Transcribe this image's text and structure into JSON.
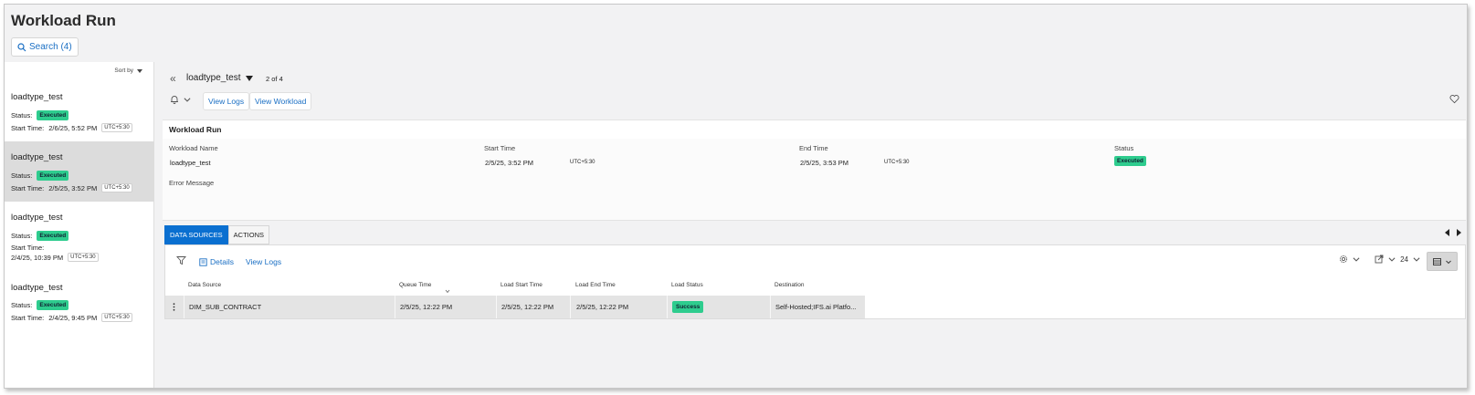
{
  "page": {
    "title": "Workload Run",
    "search_label": "Search (4)"
  },
  "sidebar": {
    "sort_label": "Sort by",
    "items": [
      {
        "name": "loadtype_test",
        "status_label": "Status:",
        "status": "Executed",
        "start_label": "Start Time:",
        "start_time": "2/6/25, 5:52 PM",
        "tz": "UTC+5:30"
      },
      {
        "name": "loadtype_test",
        "status_label": "Status:",
        "status": "Executed",
        "start_label": "Start Time:",
        "start_time": "2/5/25, 3:52 PM",
        "tz": "UTC+5:30"
      },
      {
        "name": "loadtype_test",
        "status_label": "Status:",
        "status": "Executed",
        "start_label": "Start Time:",
        "start_time": "2/4/25, 10:39 PM",
        "tz": "UTC+5:30"
      },
      {
        "name": "loadtype_test",
        "status_label": "Status:",
        "status": "Executed",
        "start_label": "Start Time:",
        "start_time": "2/4/25, 9:45 PM",
        "tz": "UTC+5:30"
      }
    ]
  },
  "header": {
    "run_name": "loadtype_test",
    "page_count": "2 of 4",
    "view_logs": "View Logs",
    "view_workload": "View Workload"
  },
  "workload_run": {
    "title": "Workload Run",
    "workload_name_label": "Workload Name",
    "workload_name": "loadtype_test",
    "start_time_label": "Start Time",
    "start_time": "2/5/25, 3:52 PM",
    "start_tz": "UTC+5:30",
    "end_time_label": "End Time",
    "end_time": "2/5/25, 3:53 PM",
    "end_tz": "UTC+5:30",
    "status_label": "Status",
    "status": "Executed",
    "error_label": "Error Message"
  },
  "tabs": [
    {
      "label": "DATA SOURCES"
    },
    {
      "label": "ACTIONS"
    }
  ],
  "datasources": {
    "details": "Details",
    "view_logs": "View Logs",
    "page_size": "24",
    "columns": [
      "Data Source",
      "Queue Time",
      "Load Start Time",
      "Load End Time",
      "Load Status",
      "Destination"
    ],
    "rows": [
      {
        "data_source": "DIM_SUB_CONTRACT",
        "queue_time": "2/5/25, 12:22 PM",
        "load_start": "2/5/25, 12:22 PM",
        "load_end": "2/5/25, 12:22 PM",
        "status": "Success",
        "destination": "Self-Hosted;IFS.ai Platfo..."
      }
    ]
  },
  "colors": {
    "accent": "#0a6fd0",
    "link": "#1a6fc4",
    "status_green": "#2ecc8e"
  }
}
